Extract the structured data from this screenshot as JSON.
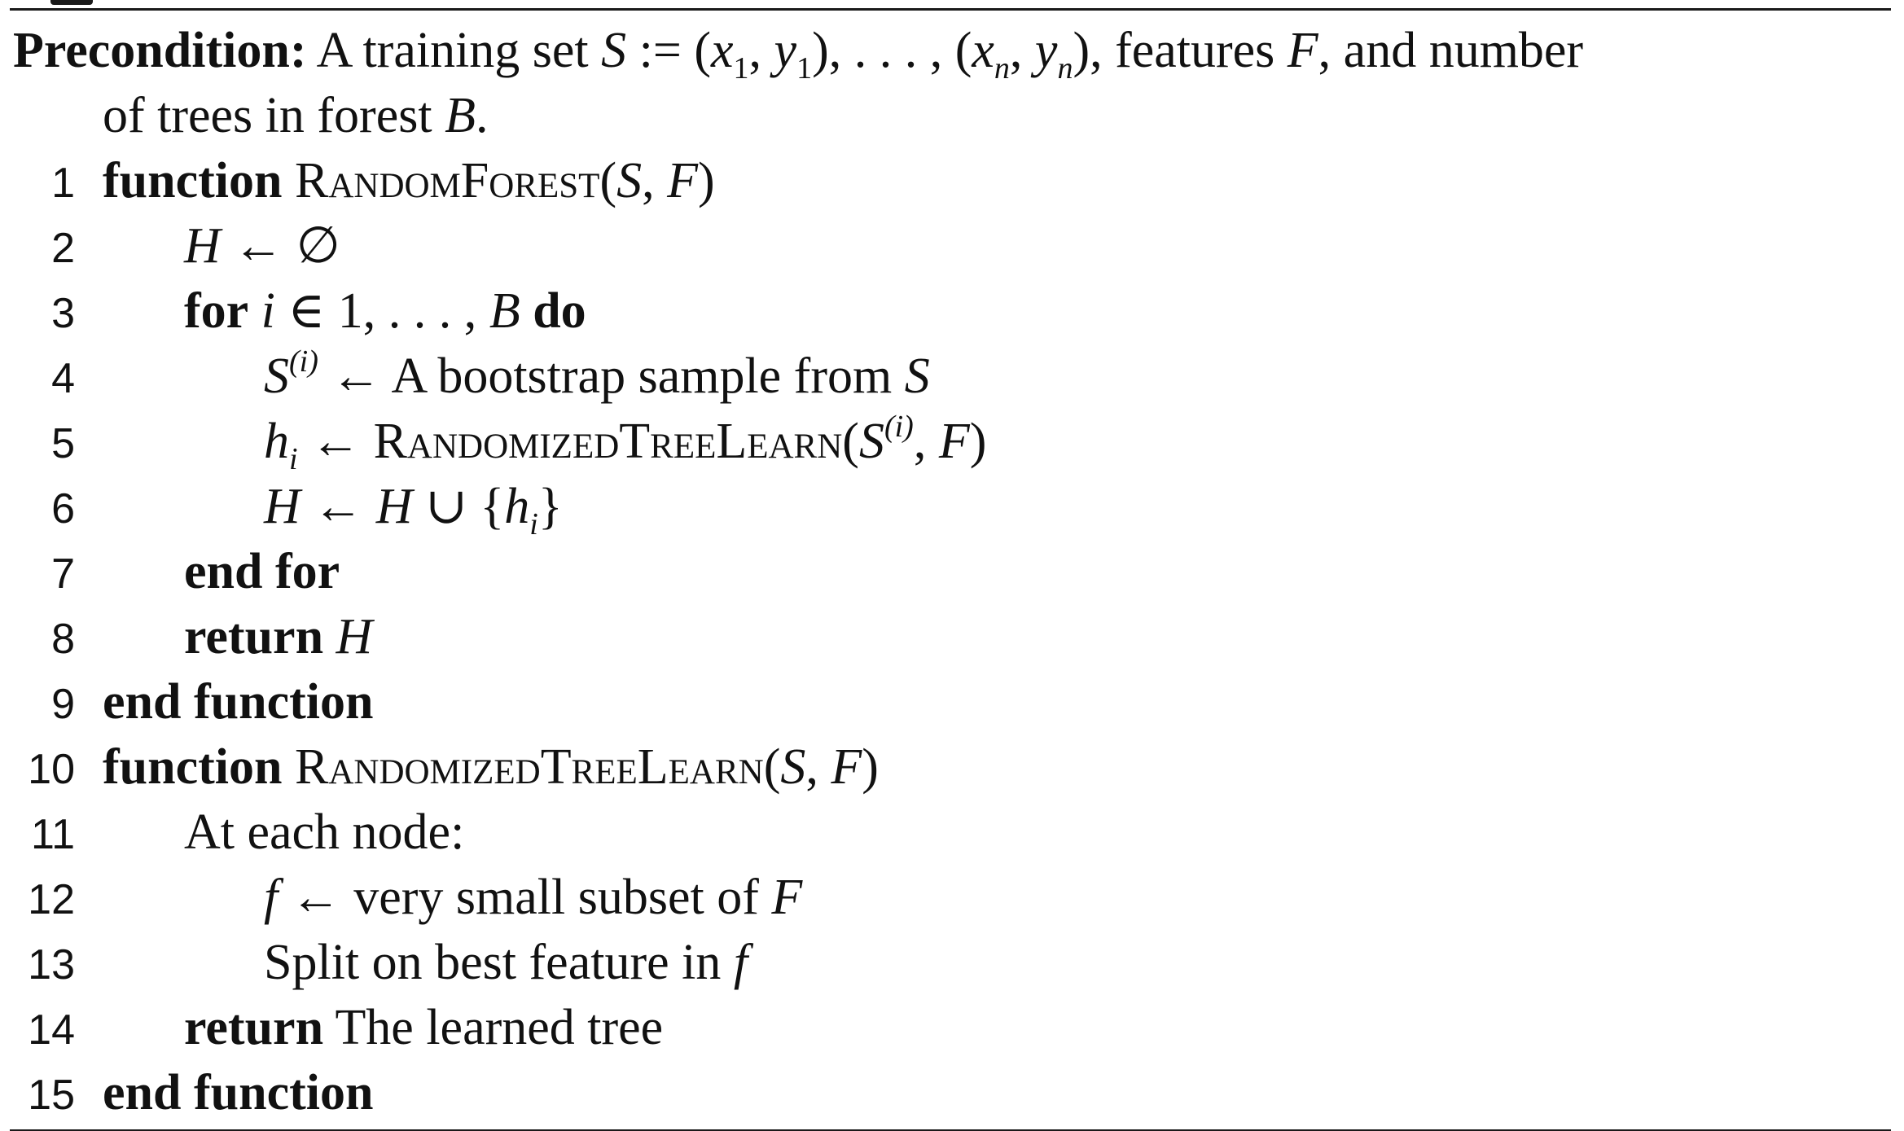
{
  "precondition": {
    "label": "Precondition:",
    "text1": "A training set",
    "S": "S",
    "assign": ":= (",
    "x1": "x",
    "one_a": "1",
    "comma1": ",",
    "y1": "y",
    "one_b": "1",
    "mid": "), . . . , (",
    "xn": "x",
    "n_a": "n",
    "comma2": ",",
    "yn": "y",
    "n_b": "n",
    "close": "),",
    "text2": "features",
    "F": "F",
    "text3": ", and number",
    "text4": "of trees in forest",
    "B": "B",
    "period": "."
  },
  "lines": [
    {
      "num": "1",
      "kw1": "function",
      "name": "RandomForest",
      "open": "(",
      "a": "S",
      "sep": ", ",
      "b": "F",
      "close": ")"
    },
    {
      "num": "2",
      "lhs": "H",
      "arrow": " ← ",
      "rhs": "∅"
    },
    {
      "num": "3",
      "kw1": "for",
      "var": "i",
      "mid": " ∈ 1, . . . , ",
      "B": "B",
      "kw2": "do"
    },
    {
      "num": "4",
      "S": "S",
      "sup": "(i)",
      "arrow": " ← ",
      "text": "A bootstrap sample from",
      "S2": "S"
    },
    {
      "num": "5",
      "h": "h",
      "sub": "i",
      "arrow": " ← ",
      "name": "RandomizedTreeLearn",
      "open": "(",
      "S": "S",
      "sup": "(i)",
      "sep": ", ",
      "F": "F",
      "close": ")"
    },
    {
      "num": "6",
      "H": "H",
      "arrow": " ← ",
      "H2": "H",
      "union": " ∪ {",
      "h": "h",
      "sub": "i",
      "close": "}"
    },
    {
      "num": "7",
      "kw": "end for"
    },
    {
      "num": "8",
      "kw": "return",
      "val": "H"
    },
    {
      "num": "9",
      "kw": "end function"
    },
    {
      "num": "10",
      "kw1": "function",
      "name": "RandomizedTreeLearn",
      "open": "(",
      "a": "S",
      "sep": ", ",
      "b": "F",
      "close": ")"
    },
    {
      "num": "11",
      "text": "At each node:"
    },
    {
      "num": "12",
      "f": "f",
      "arrow": " ← ",
      "text": "very small subset of",
      "F": "F"
    },
    {
      "num": "13",
      "text": "Split on best feature in",
      "f": "f"
    },
    {
      "num": "14",
      "kw": "return",
      "text": "The learned tree"
    },
    {
      "num": "15",
      "kw": "end function"
    }
  ]
}
